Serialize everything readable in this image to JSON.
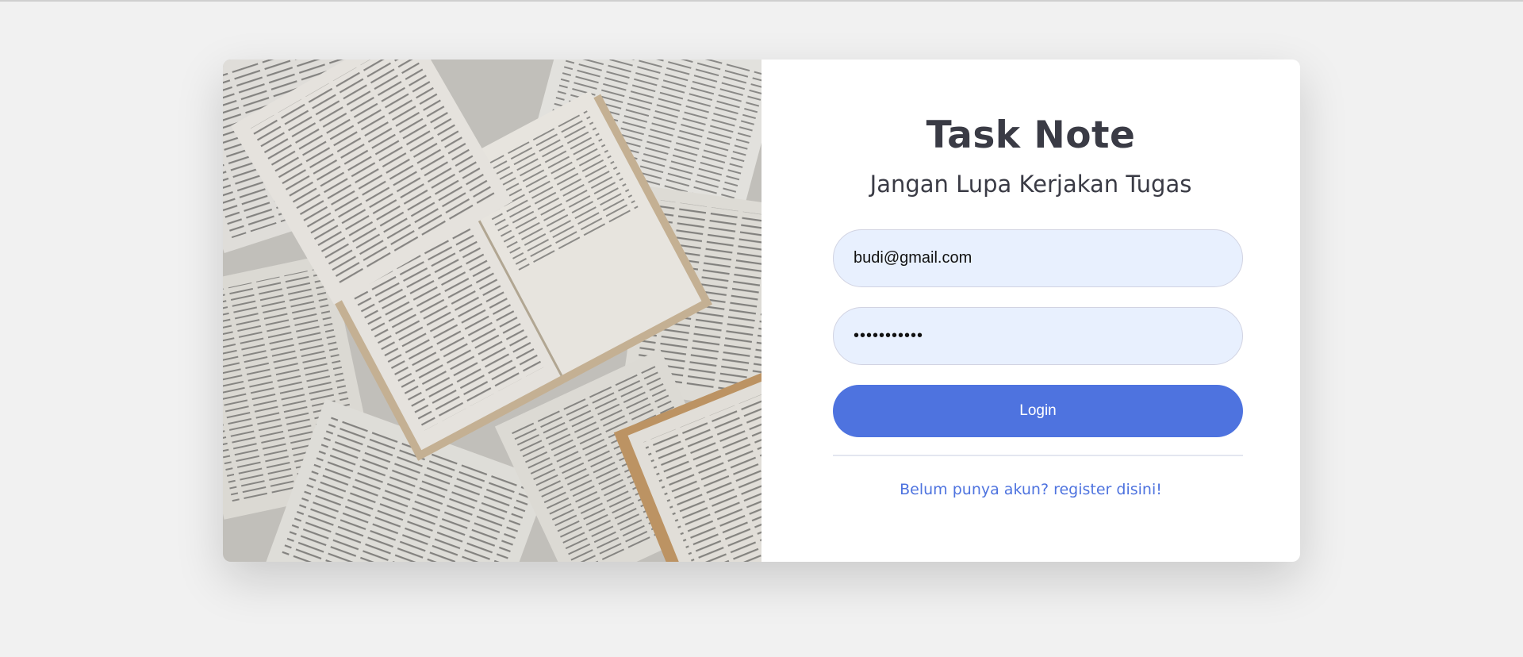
{
  "app": {
    "title": "Task Note",
    "subtitle": "Jangan Lupa Kerjakan Tugas"
  },
  "form": {
    "email_value": "budi@gmail.com",
    "password_value": "Password123",
    "login_label": "Login",
    "register_link": "Belum punya akun? register disini!"
  },
  "colors": {
    "background": "#f1f1f1",
    "card": "#ffffff",
    "accent": "#4e73df",
    "input_fill": "#e8f0fe",
    "heading": "#3a3b45"
  },
  "image": {
    "subject": "open-books-photo"
  }
}
